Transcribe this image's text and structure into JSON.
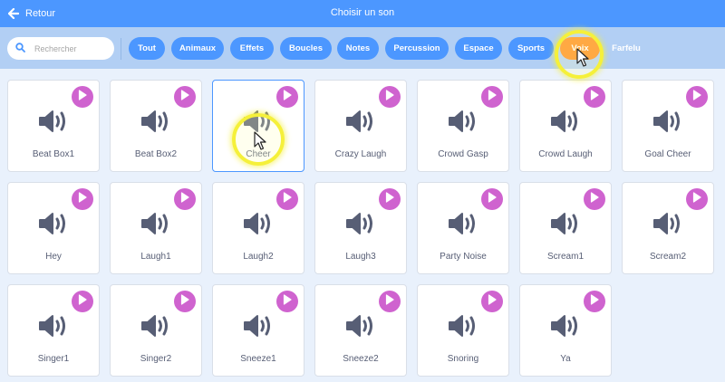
{
  "header": {
    "back_label": "Retour",
    "title": "Choisir un son"
  },
  "search": {
    "placeholder": "Rechercher",
    "value": ""
  },
  "filters": [
    {
      "label": "Tout",
      "active": false
    },
    {
      "label": "Animaux",
      "active": false
    },
    {
      "label": "Effets",
      "active": false
    },
    {
      "label": "Boucles",
      "active": false
    },
    {
      "label": "Notes",
      "active": false
    },
    {
      "label": "Percussion",
      "active": false
    },
    {
      "label": "Espace",
      "active": false
    },
    {
      "label": "Sports",
      "active": false
    },
    {
      "label": "Voix",
      "active": true
    },
    {
      "label": "Farfelu",
      "active": false
    }
  ],
  "sounds": [
    {
      "label": "Beat Box1"
    },
    {
      "label": "Beat Box2"
    },
    {
      "label": "Cheer",
      "selected": true
    },
    {
      "label": "Crazy Laugh"
    },
    {
      "label": "Crowd Gasp"
    },
    {
      "label": "Crowd Laugh"
    },
    {
      "label": "Goal Cheer"
    },
    {
      "label": "Hey"
    },
    {
      "label": "Laugh1"
    },
    {
      "label": "Laugh2"
    },
    {
      "label": "Laugh3"
    },
    {
      "label": "Party Noise"
    },
    {
      "label": "Scream1"
    },
    {
      "label": "Scream2"
    },
    {
      "label": "Singer1"
    },
    {
      "label": "Singer2"
    },
    {
      "label": "Sneeze1"
    },
    {
      "label": "Sneeze2"
    },
    {
      "label": "Snoring"
    },
    {
      "label": "Ya"
    }
  ],
  "colors": {
    "header": "#4c97ff",
    "filterbar": "#b2cff4",
    "chip": "#4c97ff",
    "chip_active": "#ff8c1a",
    "play_button": "#cf63cf",
    "speaker_icon": "#575e75",
    "background": "#e9f1fc"
  },
  "icons": {
    "back": "arrow-left-icon",
    "search": "magnifier-icon",
    "play": "play-icon",
    "sound": "speaker-icon"
  }
}
